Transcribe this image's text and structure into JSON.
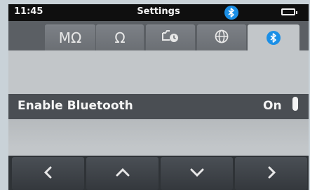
{
  "status_bar": {
    "time": "11:45",
    "title": "Settings",
    "bluetooth_icon": "bluetooth-icon",
    "battery_icon": "battery-icon"
  },
  "tabs": [
    {
      "label": "MΩ",
      "icon": null,
      "active": false
    },
    {
      "label": "Ω",
      "icon": null,
      "active": false
    },
    {
      "label": "",
      "icon": "timer-clock-icon",
      "active": false
    },
    {
      "label": "",
      "icon": "globe-icon",
      "active": false
    },
    {
      "label": "",
      "icon": "bluetooth-icon",
      "active": true
    }
  ],
  "setting": {
    "label": "Enable Bluetooth",
    "value": "On"
  },
  "softkeys": [
    {
      "icon": "chevron-left-icon"
    },
    {
      "icon": "chevron-up-icon"
    },
    {
      "icon": "chevron-down-icon"
    },
    {
      "icon": "chevron-right-icon"
    }
  ],
  "colors": {
    "accent": "#1b8fe6",
    "status_bar_bg": "#0f0f0f",
    "selected_row_bg": "#4a4e53",
    "content_bg": "#c2c6c9"
  }
}
